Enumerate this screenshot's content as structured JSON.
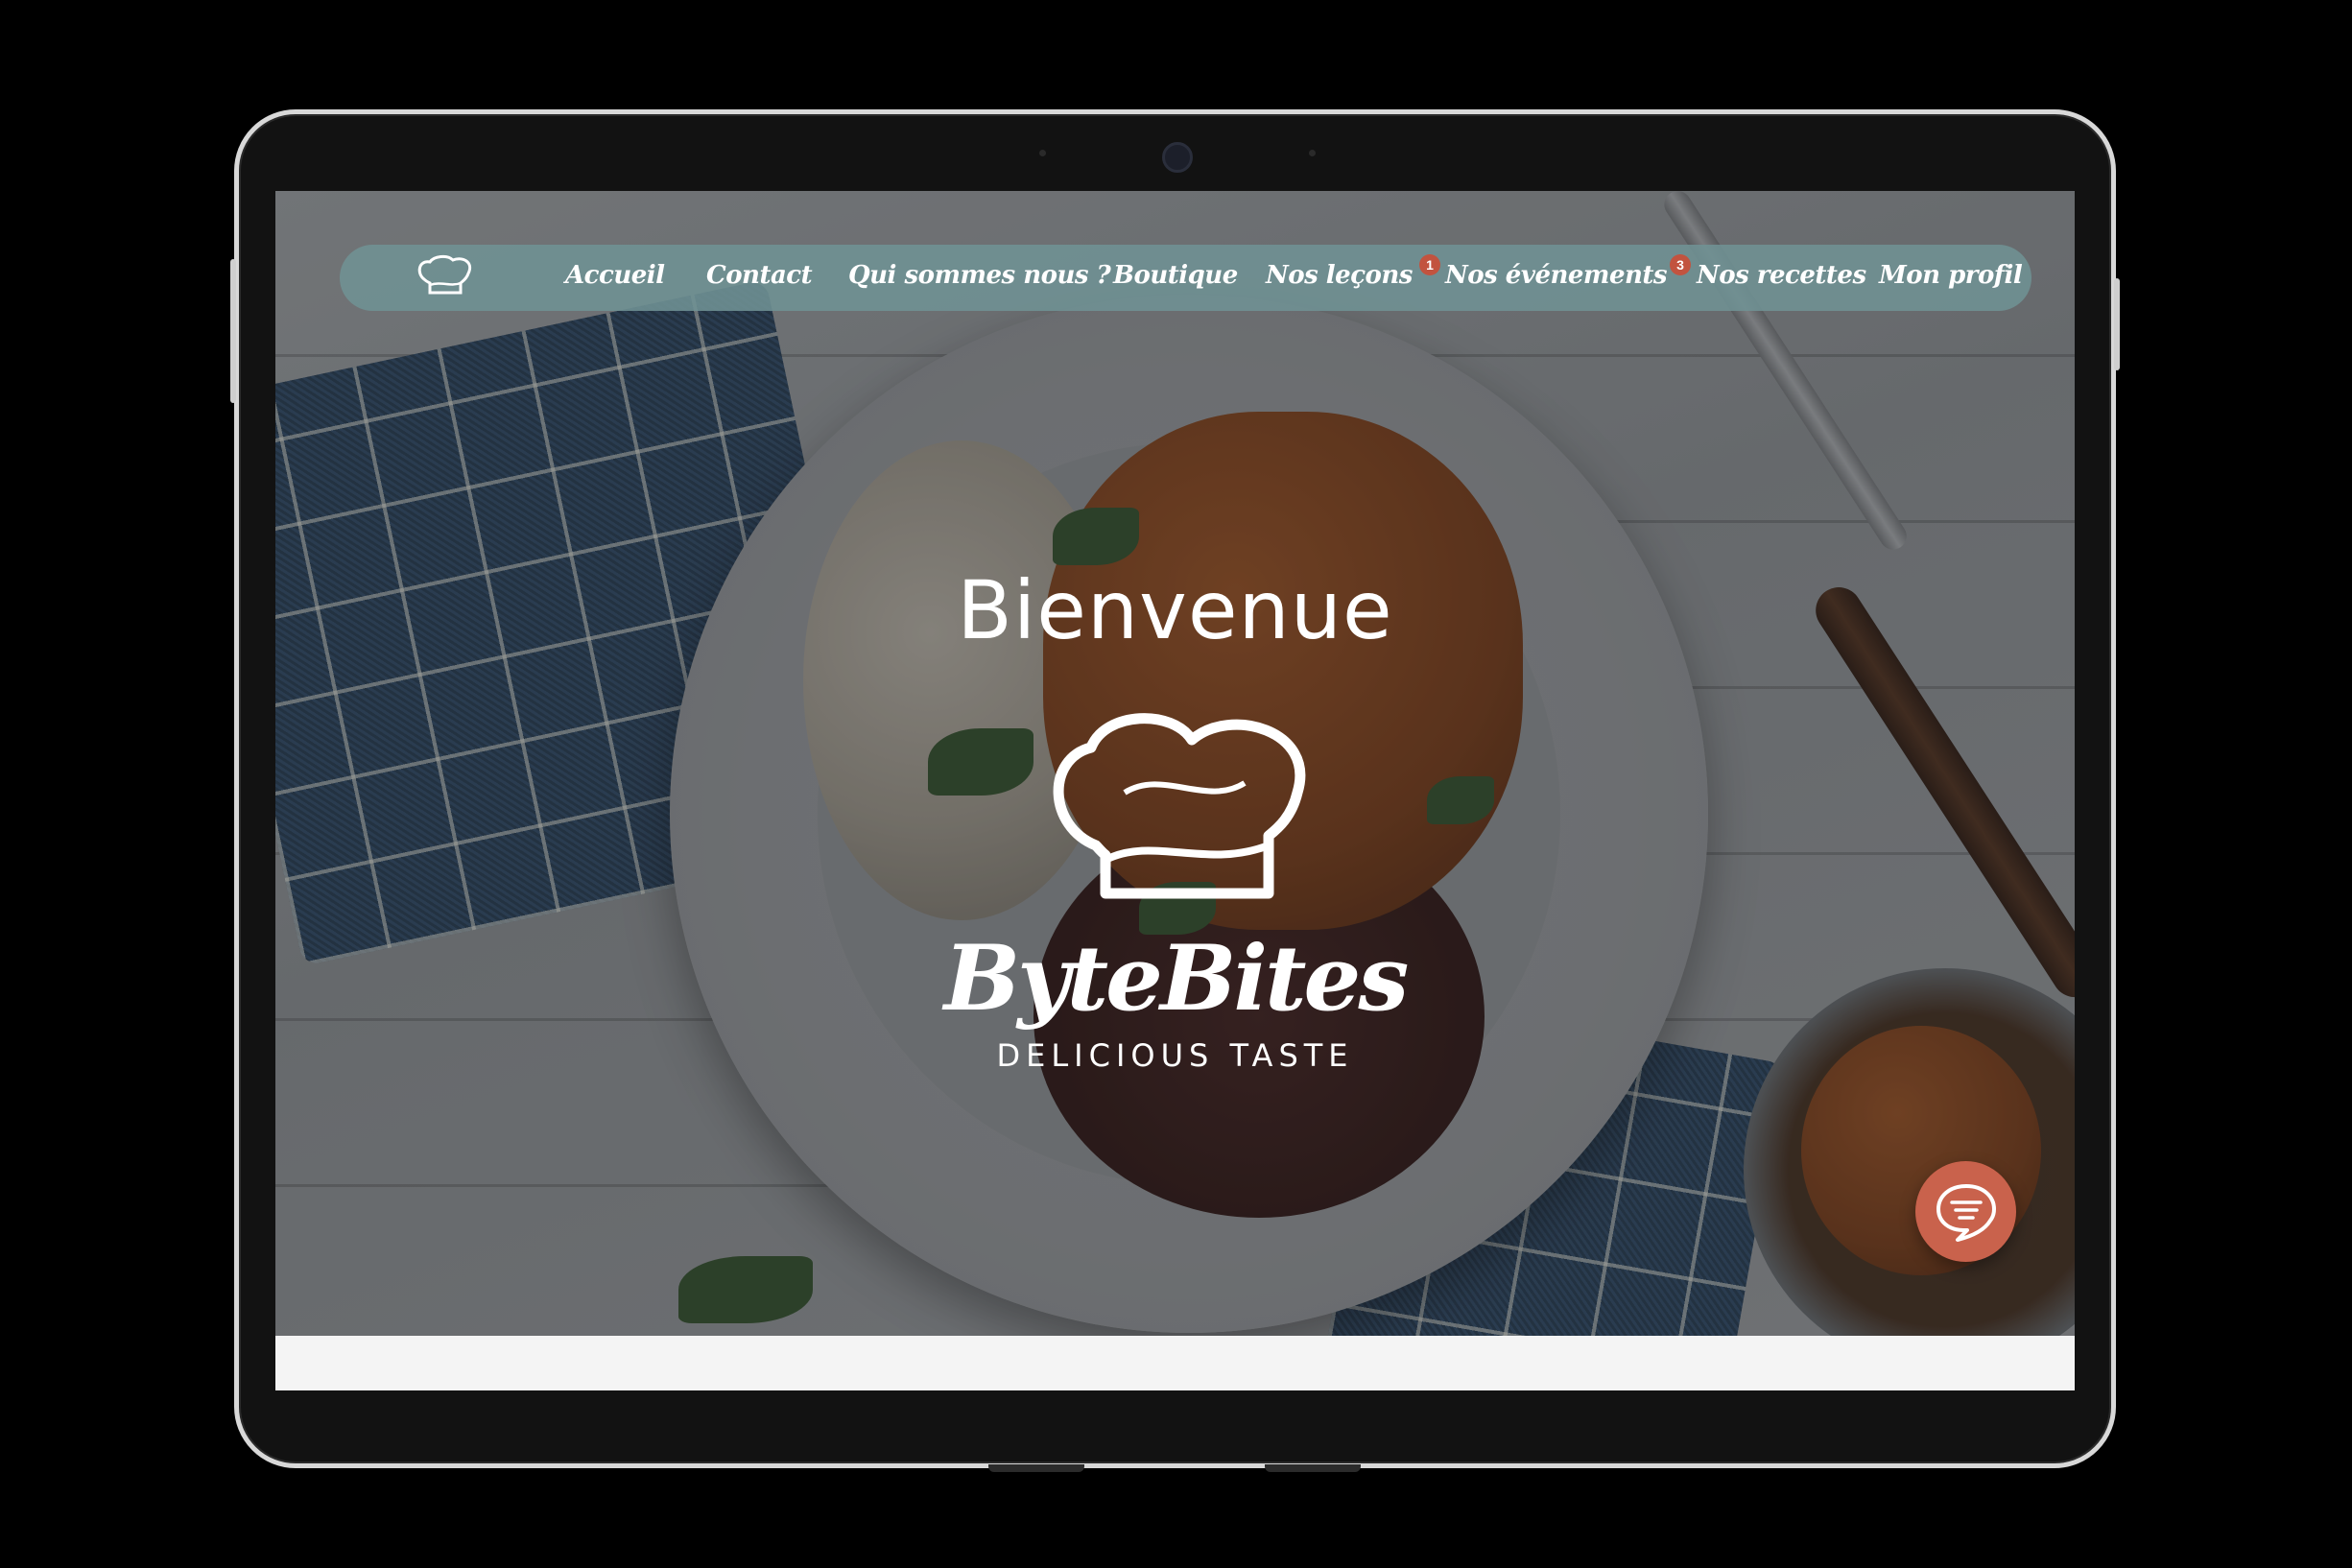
{
  "nav": {
    "items": [
      {
        "label": "Accueil"
      },
      {
        "label": "Contact"
      },
      {
        "label": "Qui sommes nous ?"
      },
      {
        "label": "Boutique"
      },
      {
        "label": "Nos leçons",
        "badge": "1"
      },
      {
        "label": "Nos événements",
        "badge": "3"
      },
      {
        "label": "Nos recettes"
      },
      {
        "label": "Mon profil"
      }
    ],
    "logo_icon": "chef-hat-icon"
  },
  "hero": {
    "welcome": "Bienvenue",
    "brand": "ByteBites",
    "tagline": "DELICIOUS TASTE",
    "logo_icon": "chef-hat-icon"
  },
  "chat": {
    "icon": "chat-bubble-icon"
  },
  "colors": {
    "navbar": "#709294",
    "badge": "#c2533f",
    "chat_button": "#c9624c",
    "text": "#ffffff"
  }
}
